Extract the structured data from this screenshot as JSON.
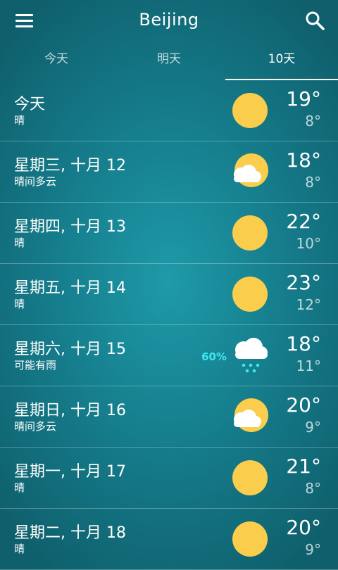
{
  "header": {
    "title": "Beijing",
    "menu_icon": "hamburger-menu-icon",
    "search_icon": "search-icon"
  },
  "tabs": [
    {
      "label": "今天",
      "active": false
    },
    {
      "label": "明天",
      "active": false
    },
    {
      "label": "10天",
      "active": true
    }
  ],
  "colors": {
    "sun": "#fbcd4d",
    "cloud": "#ffffff",
    "rain": "#3ee8f0",
    "background": "#167f8e"
  },
  "forecast": [
    {
      "day": "今天",
      "condition": "晴",
      "icon": "sunny-icon",
      "high": "19°",
      "low": "8°",
      "precip": ""
    },
    {
      "day": "星期三, 十月 12",
      "condition": "晴间多云",
      "icon": "partly-cloudy-icon",
      "high": "18°",
      "low": "8°",
      "precip": ""
    },
    {
      "day": "星期四, 十月 13",
      "condition": "晴",
      "icon": "sunny-icon",
      "high": "22°",
      "low": "10°",
      "precip": ""
    },
    {
      "day": "星期五, 十月 14",
      "condition": "晴",
      "icon": "sunny-icon",
      "high": "23°",
      "low": "12°",
      "precip": ""
    },
    {
      "day": "星期六, 十月 15",
      "condition": "可能有雨",
      "icon": "rain-cloud-icon",
      "high": "18°",
      "low": "11°",
      "precip": "60%"
    },
    {
      "day": "星期日, 十月 16",
      "condition": "晴间多云",
      "icon": "partly-cloudy-icon",
      "high": "20°",
      "low": "9°",
      "precip": ""
    },
    {
      "day": "星期一, 十月 17",
      "condition": "晴",
      "icon": "sunny-icon",
      "high": "21°",
      "low": "8°",
      "precip": ""
    },
    {
      "day": "星期二, 十月 18",
      "condition": "晴",
      "icon": "sunny-icon",
      "high": "20°",
      "low": "9°",
      "precip": ""
    }
  ]
}
